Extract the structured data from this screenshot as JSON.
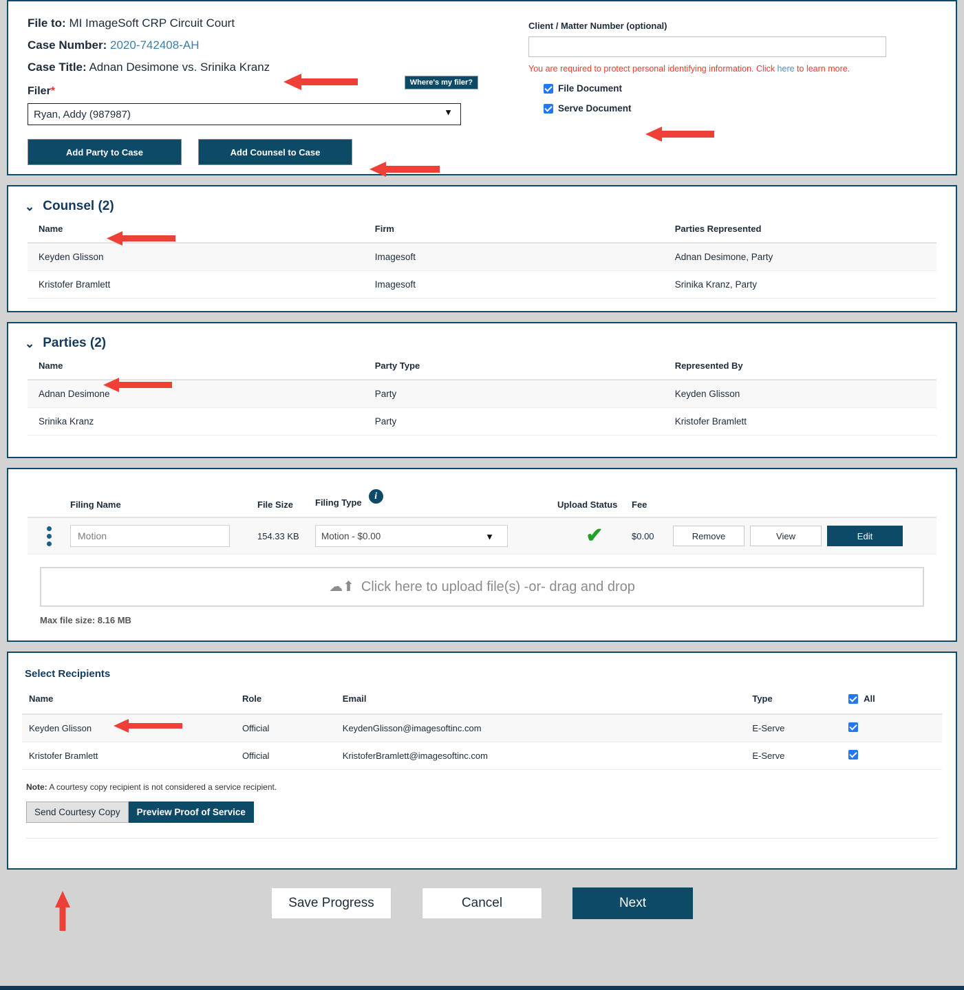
{
  "case": {
    "file_to_label": "File to:",
    "file_to_value": "MI ImageSoft CRP Circuit Court",
    "case_number_label": "Case Number:",
    "case_number_value": "2020-742408-AH",
    "case_title_label": "Case Title:",
    "case_title_value": "Adnan Desimone vs. Srinika Kranz",
    "filer_label": "Filer",
    "filer_required_mark": "*",
    "filer_tooltip": "Where's my filer?",
    "filer_selected": "Ryan, Addy (987987)",
    "add_party_button": "Add Party to Case",
    "add_counsel_button": "Add Counsel to Case"
  },
  "client_matter": {
    "label": "Client / Matter Number (optional)",
    "value": "",
    "placeholder": "",
    "pii_warning_before": "You are required to protect personal identifying information. Click ",
    "pii_link": "here",
    "pii_warning_after": " to learn more.",
    "file_document_label": "File Document",
    "file_document_checked": true,
    "serve_document_label": "Serve Document",
    "serve_document_checked": true
  },
  "counsel": {
    "title": "Counsel (2)",
    "caret": "⌄",
    "columns": [
      "Name",
      "Firm",
      "Parties Represented"
    ],
    "rows": [
      {
        "name": "Keyden Glisson",
        "firm": "Imagesoft",
        "parties": "Adnan Desimone, Party"
      },
      {
        "name": "Kristofer Bramlett",
        "firm": "Imagesoft",
        "parties": "Srinika Kranz, Party"
      }
    ]
  },
  "parties": {
    "title": "Parties (2)",
    "caret": "⌄",
    "columns": [
      "Name",
      "Party Type",
      "Represented By"
    ],
    "rows": [
      {
        "name": "Adnan Desimone",
        "type": "Party",
        "represented_by": "Keyden Glisson"
      },
      {
        "name": "Srinika Kranz",
        "type": "Party",
        "represented_by": "Kristofer Bramlett"
      }
    ]
  },
  "filing": {
    "columns": {
      "filing_name": "Filing Name",
      "file_size": "File Size",
      "filing_type": "Filing Type",
      "upload_status": "Upload Status",
      "fee": "Fee"
    },
    "info_glyph": "i",
    "row": {
      "filing_name_value": "Motion",
      "file_size": "154.33 KB",
      "filing_type_selected": "Motion - $0.00",
      "upload_status_glyph": "✔",
      "fee": "$0.00",
      "remove_button": "Remove",
      "view_button": "View",
      "edit_button": "Edit"
    },
    "dropzone_text": "Click here to upload file(s) -or- drag and drop",
    "max_file_size": "Max file size: 8.16 MB"
  },
  "recipients": {
    "title": "Select Recipients",
    "columns": [
      "Name",
      "Role",
      "Email",
      "Type"
    ],
    "all_label": "All",
    "all_checked": true,
    "rows": [
      {
        "name": "Keyden Glisson",
        "role": "Official",
        "email": "KeydenGlisson@imagesoftinc.com",
        "type": "E-Serve",
        "checked": true
      },
      {
        "name": "Kristofer Bramlett",
        "role": "Official",
        "email": "KristoferBramlett@imagesoftinc.com",
        "type": "E-Serve",
        "checked": true
      }
    ],
    "note_label": "Note:",
    "note_text": " A courtesy copy recipient is not considered a service recipient.",
    "send_courtesy_copy_button": "Send Courtesy Copy",
    "preview_proof_button": "Preview Proof of Service"
  },
  "footer": {
    "save_progress": "Save Progress",
    "cancel": "Cancel",
    "next": "Next"
  },
  "colors": {
    "navy": "#0d4a68",
    "page_bg": "#d3d3d3",
    "checkbox_blue": "#2278f2",
    "success_green": "#21a02b",
    "warning_red": "#ee3c2c",
    "annotation_red": "#ee4036",
    "link_blue": "#3b7fa8"
  }
}
